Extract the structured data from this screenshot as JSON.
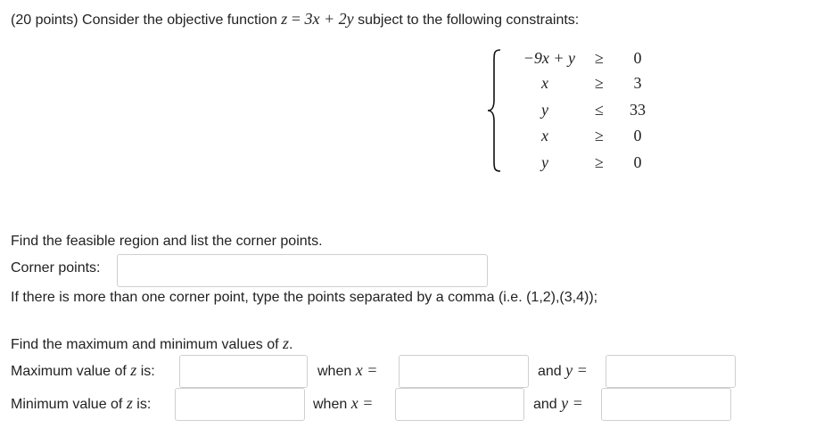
{
  "problem": {
    "intro_prefix": "(20 points) Consider the objective function",
    "objective": {
      "var": "z",
      "eq": "=",
      "expr": "3x + 2y"
    },
    "intro_suffix": "subject to the following constraints:"
  },
  "constraints": [
    {
      "lhs": "−9x + y",
      "rel": "≥",
      "rhs": "0"
    },
    {
      "lhs": "x",
      "rel": "≥",
      "rhs": "3"
    },
    {
      "lhs": "y",
      "rel": "≤",
      "rhs": "33"
    },
    {
      "lhs": "x",
      "rel": "≥",
      "rhs": "0"
    },
    {
      "lhs": "y",
      "rel": "≥",
      "rhs": "0"
    }
  ],
  "part1": {
    "instruction": "Find the feasible region and list the corner points.",
    "corner_label": "Corner points:",
    "corner_value": "",
    "hint": "If there is more than one corner point, type the points separated by a comma (i.e. (1,2),(3,4));"
  },
  "part2": {
    "instruction_prefix": "Find the maximum and minimum values of",
    "instruction_var": "z",
    "instruction_suffix": ".",
    "max_label_prefix": "Maximum value of",
    "min_label_prefix": "Minimum value of",
    "label_var": "z",
    "label_suffix": "is:",
    "when_text": "when",
    "x_eq": "x =",
    "and_text": "and",
    "y_eq": "y =",
    "max_value": "",
    "max_x": "",
    "max_y": "",
    "min_value": "",
    "min_x": "",
    "min_y": ""
  }
}
